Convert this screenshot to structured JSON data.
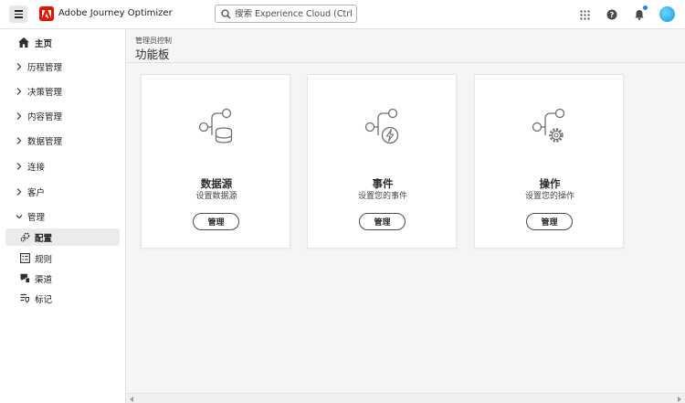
{
  "header": {
    "app_title": "Adobe Journey Optimizer",
    "search_placeholder": "搜索 Experience Cloud (Ctrl+/)",
    "icons": [
      "menu-icon",
      "adobe-logo-icon",
      "search-icon",
      "apps-grid-icon",
      "help-icon",
      "notifications-icon",
      "avatar"
    ],
    "brand_color": "#eb1000"
  },
  "sidebar": {
    "home": "主页",
    "sections": [
      {
        "label": "历程管理"
      },
      {
        "label": "决策管理"
      },
      {
        "label": "内容管理"
      },
      {
        "label": "数据管理"
      },
      {
        "label": "连接"
      },
      {
        "label": "客户"
      },
      {
        "label": "管理"
      }
    ],
    "admin_items": [
      {
        "label": "配置",
        "icon": "gears-icon",
        "active": true
      },
      {
        "label": "规则",
        "icon": "rules-icon"
      },
      {
        "label": "渠道",
        "icon": "channels-icon"
      },
      {
        "label": "标记",
        "icon": "tags-icon"
      }
    ]
  },
  "main": {
    "breadcrumb": "管理员控制",
    "title": "功能板",
    "cards": [
      {
        "title": "数据源",
        "desc": "设置数据源",
        "button": "管理",
        "icon": "datasource-icon"
      },
      {
        "title": "事件",
        "desc": "设置您的事件",
        "button": "管理",
        "icon": "event-icon"
      },
      {
        "title": "操作",
        "desc": "设置您的操作",
        "button": "管理",
        "icon": "action-icon"
      }
    ]
  }
}
